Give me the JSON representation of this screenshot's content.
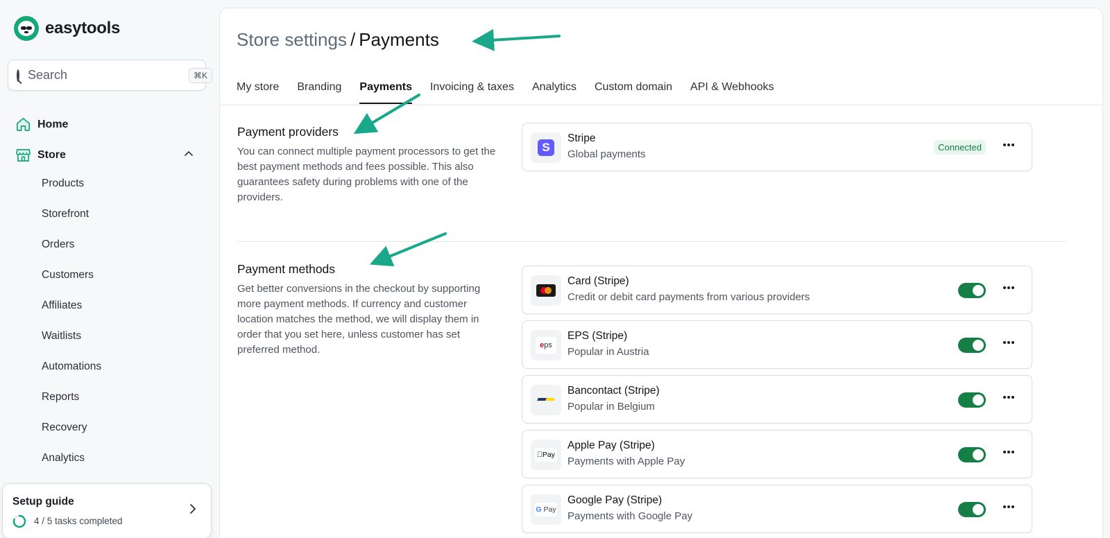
{
  "brand": {
    "name": "easytools"
  },
  "search": {
    "placeholder": "Search",
    "shortcut": "⌘K"
  },
  "nav": {
    "home": "Home",
    "store": "Store",
    "store_items": [
      "Products",
      "Storefront",
      "Orders",
      "Customers",
      "Affiliates",
      "Waitlists",
      "Automations",
      "Reports",
      "Recovery",
      "Analytics"
    ]
  },
  "setup_guide": {
    "title": "Setup guide",
    "progress_text": "4 / 5 tasks completed",
    "progress_fraction": 0.8
  },
  "page": {
    "crumb": "Store settings",
    "separator": "/",
    "current": "Payments"
  },
  "tabs": [
    "My store",
    "Branding",
    "Payments",
    "Invoicing & taxes",
    "Analytics",
    "Custom domain",
    "API & Webhooks"
  ],
  "active_tab": "Payments",
  "providers": {
    "title": "Payment providers",
    "description": "You can connect multiple payment processors to get the best payment methods and fees possible. This also guarantees safety during problems with one of the providers.",
    "items": [
      {
        "name": "Stripe",
        "desc": "Global payments",
        "status": "Connected",
        "logo": "stripe-logo"
      }
    ]
  },
  "methods": {
    "title": "Payment methods",
    "description": "Get better conversions in the checkout by supporting more payment methods. If currency and customer location matches the method, we will display them in order that you set here, unless customer has set preferred method.",
    "items": [
      {
        "name": "Card (Stripe)",
        "desc": "Credit or debit card payments from various providers",
        "enabled": true,
        "logo": "mastercard-logo"
      },
      {
        "name": "EPS (Stripe)",
        "desc": "Popular in Austria",
        "enabled": true,
        "logo": "eps-logo",
        "logo_text": "ps"
      },
      {
        "name": "Bancontact (Stripe)",
        "desc": "Popular in Belgium",
        "enabled": true,
        "logo": "bancontact-logo"
      },
      {
        "name": "Apple Pay (Stripe)",
        "desc": "Payments with Apple Pay",
        "enabled": true,
        "logo": "apple-pay-logo",
        "logo_text": "Pay"
      },
      {
        "name": "Google Pay (Stripe)",
        "desc": "Payments with Google Pay",
        "enabled": true,
        "logo": "google-pay-logo",
        "logo_text": "Pay"
      }
    ]
  },
  "colors": {
    "accent": "#14a877",
    "toggle_on": "#157f46",
    "annotation_arrow": "#1aa88a"
  }
}
